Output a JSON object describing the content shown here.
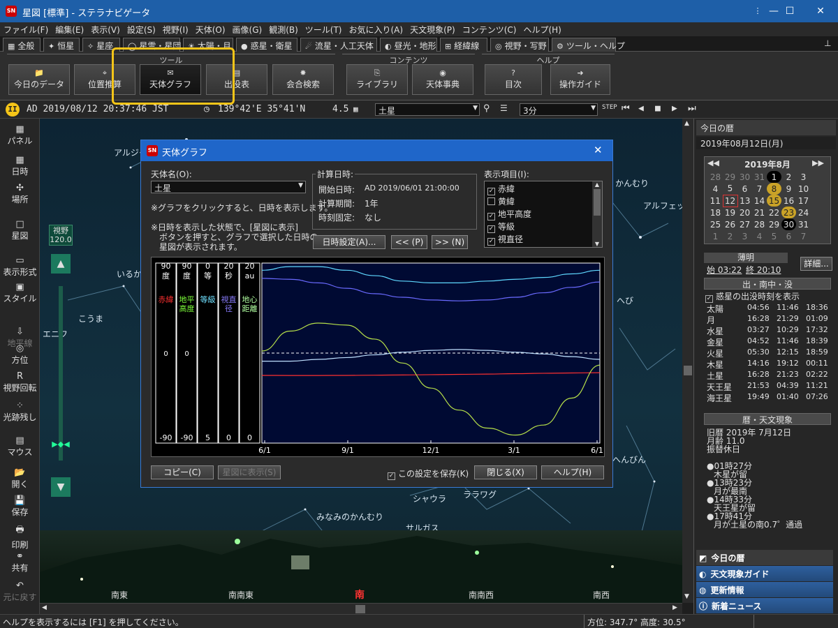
{
  "window": {
    "title": "星図 [標準] - ステラナビゲータ",
    "icon_text": "SN"
  },
  "menu": [
    "ファイル(F)",
    "編集(E)",
    "表示(V)",
    "設定(S)",
    "視野(I)",
    "天体(O)",
    "画像(G)",
    "観測(B)",
    "ツール(T)",
    "お気に入り(A)",
    "天文現象(P)",
    "コンテンツ(C)",
    "ヘルプ(H)"
  ],
  "tabs": [
    "全般",
    "恒星",
    "星座",
    "星雲・星団",
    "太陽・月",
    "惑星・衛星",
    "流星・人工天体",
    "昼光・地形",
    "経緯線",
    "視野・写野",
    "ツール・ヘルプ"
  ],
  "ribbon": {
    "groups": [
      "ツール",
      "コンテンツ",
      "ヘルプ"
    ],
    "buttons": [
      "今日のデータ",
      "位置推算",
      "天体グラフ",
      "出没表",
      "会合検索",
      "ライブラリ",
      "天体事典",
      "目次",
      "操作ガイド"
    ]
  },
  "status": {
    "datetime": "AD 2019/08/12 20:37:46 JST",
    "coords": "139°42'E 35°41'N",
    "mag": "4.5",
    "object": "土星",
    "step": "3分"
  },
  "left_toolbar": [
    "パネル",
    "日時",
    "場所",
    "星図",
    "表示形式",
    "スタイル",
    "地平線",
    "方位",
    "視野回転",
    "光跡残し",
    "マウス",
    "開く",
    "保存",
    "印刷",
    "共有",
    "元に戻す"
  ],
  "fov": {
    "label": "視野",
    "value": "120.0"
  },
  "sky_labels": [
    "アルジャ",
    "いるか",
    "こうま",
    "エニフ",
    "かんむり",
    "アルフェッカ",
    "へび",
    "へんびん",
    "シャウラ",
    "ララワグ",
    "みなみのかんむり",
    "サルガス"
  ],
  "directions": [
    "南東",
    "南南東",
    "南",
    "南南西",
    "南西"
  ],
  "dialog": {
    "title": "天体グラフ",
    "object_label": "天体名(O):",
    "object_value": "土星",
    "note1": "※グラフをクリックすると、日時を表示します。",
    "note2a": "※日時を表示した状態で、[星図に表示]",
    "note2b": "ボタンを押すと、グラフで選択した日時の",
    "note2c": "星図が表示されます。",
    "calc_title": "計算日時:",
    "start_label": "開始日時:",
    "start_value": "AD 2019/06/01 21:00:00",
    "period_label": "計算期間:",
    "period_value": "1年",
    "fixed_label": "時刻固定:",
    "fixed_value": "なし",
    "btn_datetime": "日時設定(A)...",
    "btn_prev": "<< (P)",
    "btn_next": ">> (N)",
    "items_label": "表示項目(I):",
    "items": [
      {
        "name": "赤緯",
        "checked": true
      },
      {
        "name": "黄緯",
        "checked": false
      },
      {
        "name": "地平高度",
        "checked": true
      },
      {
        "name": "等級",
        "checked": true
      },
      {
        "name": "視直径",
        "checked": true
      }
    ],
    "btn_copy": "コピー(C)",
    "btn_show": "星図に表示(S)",
    "save_label": "この設定を保存(K)",
    "btn_close": "閉じる(X)",
    "btn_help": "ヘルプ(H)"
  },
  "chart_data": {
    "type": "line",
    "x_ticks": [
      "6/1",
      "9/1",
      "12/1",
      "3/1",
      "6/1"
    ],
    "axes": [
      {
        "top": "90",
        "unit": "度",
        "mid": "0",
        "bottom": "-90",
        "label": "赤緯",
        "color": "#ff3030"
      },
      {
        "top": "90",
        "unit": "度",
        "mid": "0",
        "bottom": "-90",
        "label": "地平高度",
        "color": "#7dff3a"
      },
      {
        "top": "0",
        "unit": "等",
        "mid": "",
        "bottom": "5",
        "label": "等級",
        "color": "#6fe0ff"
      },
      {
        "top": "20",
        "unit": "秒",
        "mid": "",
        "bottom": "0",
        "label": "視直径",
        "color": "#8a7dff"
      },
      {
        "top": "20",
        "unit": "au",
        "mid": "",
        "bottom": "0",
        "label": "地心距離",
        "color": "#b0ffa0"
      }
    ],
    "series": [
      {
        "name": "赤緯",
        "color": "#ff3030",
        "values": [
          -22.3,
          -22.4,
          -22.4,
          -22.3,
          -22.1,
          -21.9,
          -21.6,
          -21.3,
          -21.0,
          -20.6,
          -20.2,
          -19.9,
          -19.6
        ]
      },
      {
        "name": "地平高度",
        "color": "#b6e04a",
        "values": [
          2,
          22,
          30,
          28,
          14,
          -10,
          -35,
          -57,
          -75,
          -82,
          -72,
          -45,
          -12
        ]
      },
      {
        "name": "等級",
        "color": "#5fd8ff",
        "values": [
          0.2,
          0.1,
          0.1,
          0.2,
          0.35,
          0.5,
          0.55,
          0.55,
          0.5,
          0.45,
          0.4,
          0.3,
          0.2
        ]
      },
      {
        "name": "視直径",
        "color": "#6a6aff",
        "values": [
          18.3,
          18.2,
          17.8,
          17.2,
          16.6,
          16.2,
          15.9,
          15.8,
          15.9,
          16.2,
          16.7,
          17.3,
          17.9
        ]
      },
      {
        "name": "地心距離",
        "color": "#c0e0ff",
        "values": [
          9.1,
          9.1,
          9.3,
          9.5,
          9.8,
          10.1,
          10.3,
          10.4,
          10.3,
          10.1,
          9.9,
          9.6,
          9.3
        ]
      }
    ]
  },
  "right": {
    "header": "今日の暦",
    "date": "2019年08月12日(月)",
    "cal_title": "2019年8月",
    "cal_rows": [
      [
        "28",
        "29",
        "30",
        "31",
        "1",
        "2",
        "3"
      ],
      [
        "4",
        "5",
        "6",
        "7",
        "8",
        "9",
        "10"
      ],
      [
        "11",
        "12",
        "13",
        "14",
        "15",
        "16",
        "17"
      ],
      [
        "18",
        "19",
        "20",
        "21",
        "22",
        "23",
        "24"
      ],
      [
        "25",
        "26",
        "27",
        "28",
        "29",
        "30",
        "31"
      ],
      [
        "1",
        "2",
        "3",
        "4",
        "5",
        "6",
        "7"
      ]
    ],
    "twilight_title": "薄明",
    "twilight_start": "始 03:22",
    "twilight_end": "終 20:10",
    "detail_btn": "詳細...",
    "rise_title": "出・南中・没",
    "rise_check": "惑星の出没時刻を表示",
    "rise_rows": [
      [
        "太陽",
        "04:56",
        "11:46",
        "18:36"
      ],
      [
        "月",
        "16:28",
        "21:29",
        "01:09"
      ],
      [
        "水星",
        "03:27",
        "10:29",
        "17:32"
      ],
      [
        "金星",
        "04:52",
        "11:46",
        "18:39"
      ],
      [
        "火星",
        "05:30",
        "12:15",
        "18:59"
      ],
      [
        "木星",
        "14:16",
        "19:12",
        "00:11"
      ],
      [
        "土星",
        "16:28",
        "21:23",
        "02:22"
      ],
      [
        "天王星",
        "21:53",
        "04:39",
        "11:21"
      ],
      [
        "海王星",
        "19:49",
        "01:40",
        "07:26"
      ]
    ],
    "cal_section": "暦・天文現象",
    "lunar": "旧暦 2019年 7月12日",
    "moonage": "月齢 11.0",
    "holiday": "振替休日",
    "events": [
      [
        "●01時27分",
        "木星が留"
      ],
      [
        "●13時23分",
        "月が最南"
      ],
      [
        "●14時33分",
        "天王星が留"
      ],
      [
        "●17時41分",
        "月が土星の南0.7゜通過"
      ]
    ],
    "nav": [
      "今日の暦",
      "天文現象ガイド",
      "更新情報",
      "新着ニュース"
    ]
  },
  "bottom": {
    "help": "ヘルプを表示するには [F1] を押してください。",
    "azimuth": "方位: 347.7°  高度: 30.5°"
  }
}
